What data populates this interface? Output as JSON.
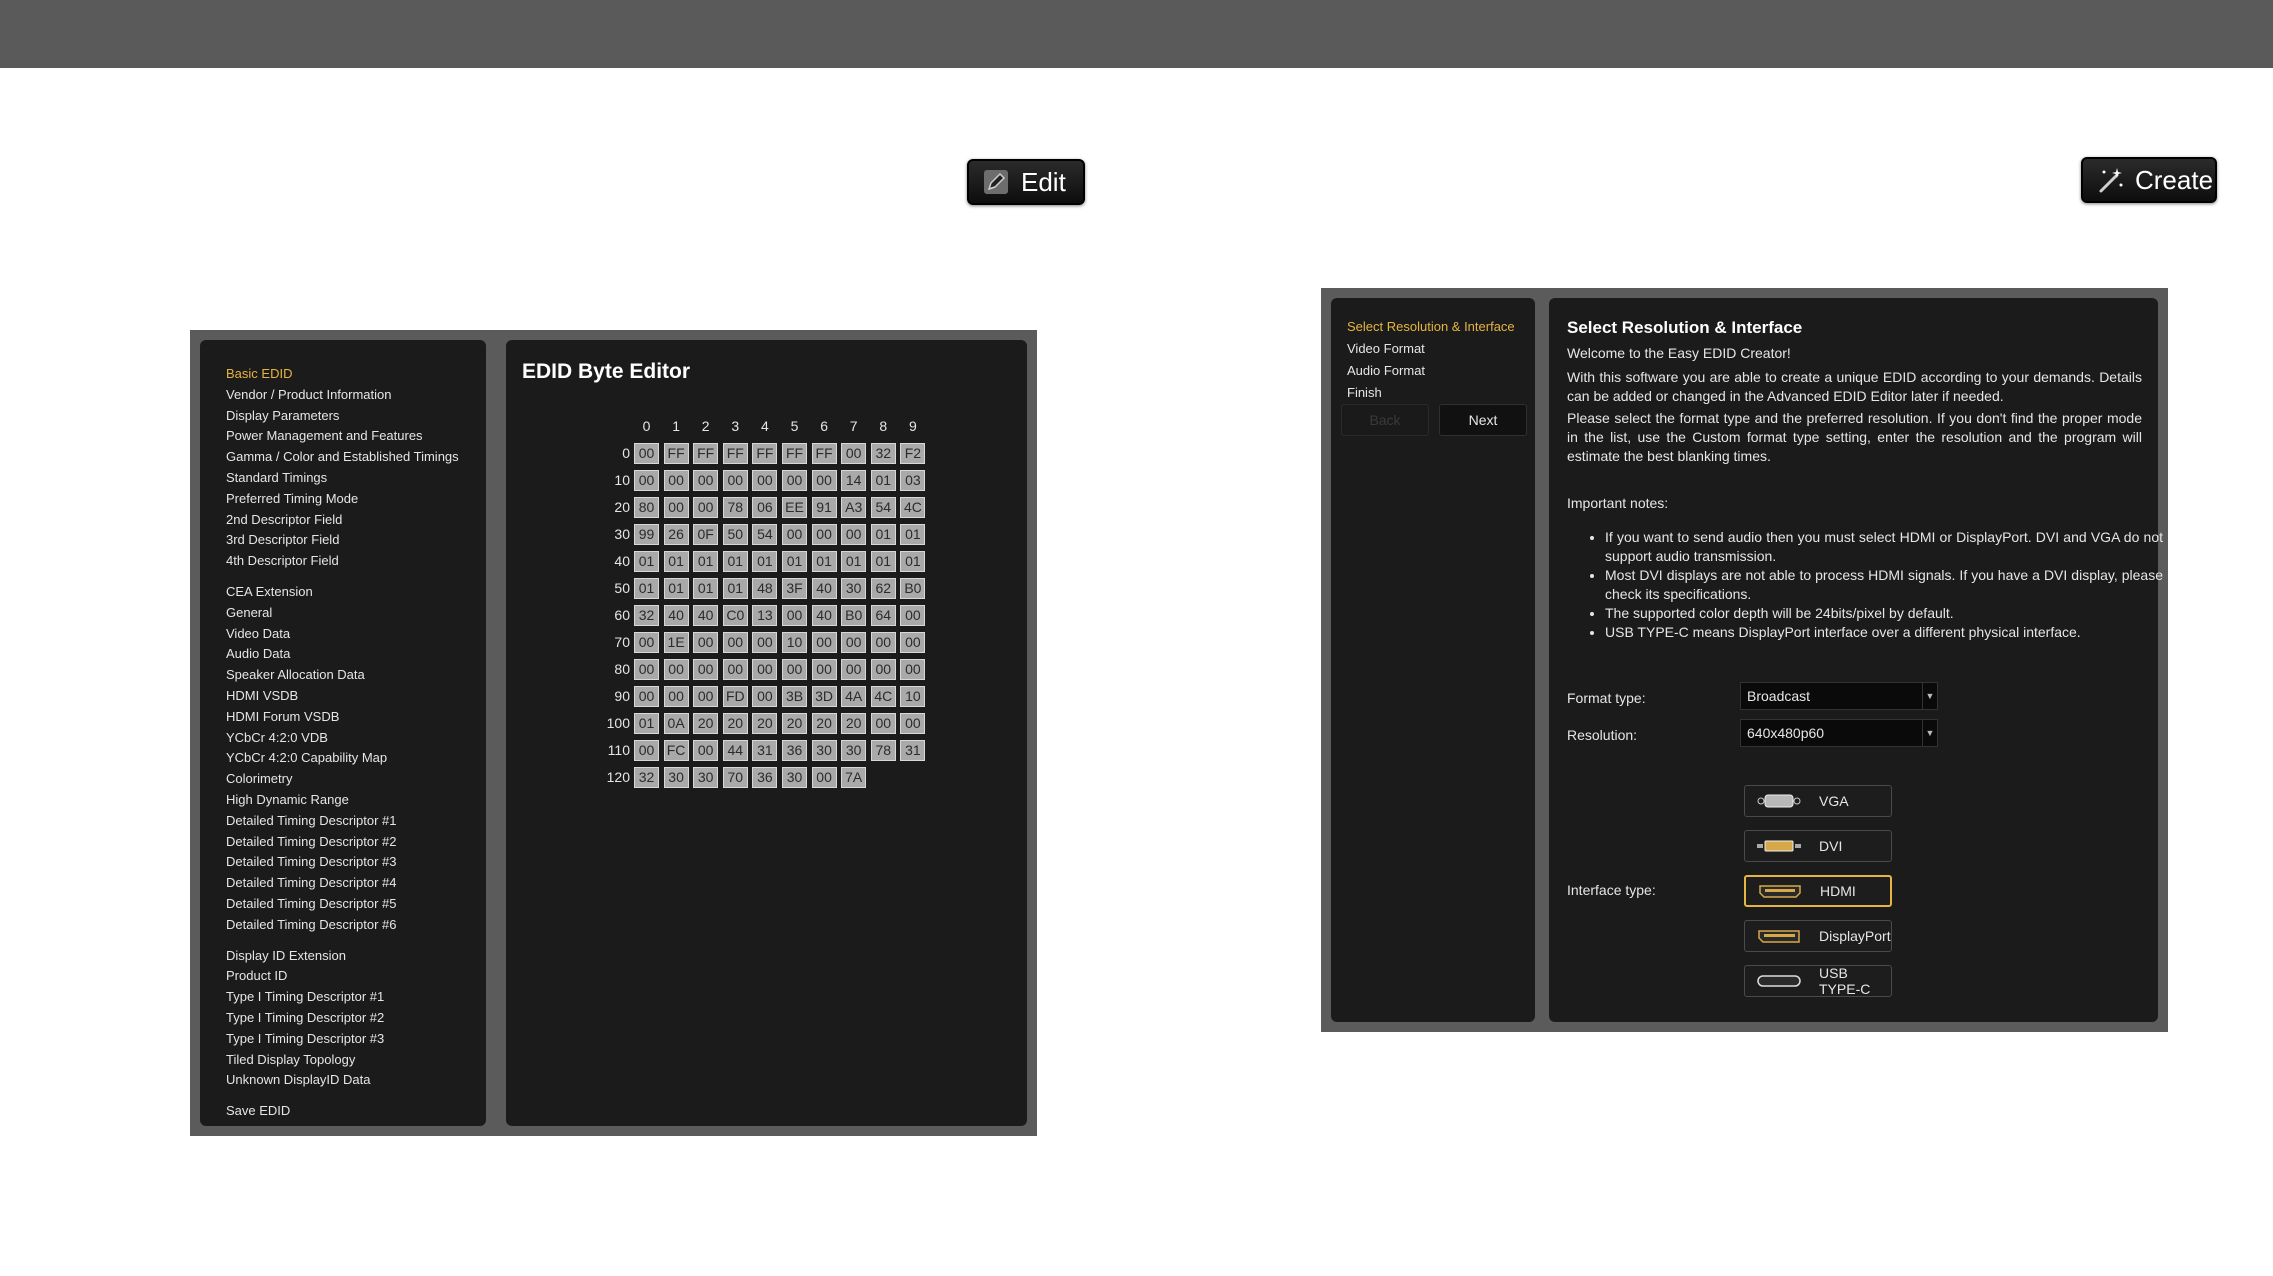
{
  "buttons": {
    "edit_label": "Edit",
    "create_label": "Create"
  },
  "editor": {
    "nav": {
      "basic": [
        "Basic EDID",
        "Vendor / Product Information",
        "Display Parameters",
        "Power Management and Features",
        "Gamma / Color and Established Timings",
        "Standard Timings",
        "Preferred Timing Mode",
        "2nd Descriptor Field",
        "3rd Descriptor Field",
        "4th Descriptor Field"
      ],
      "cea": [
        "CEA Extension",
        "General",
        "Video Data",
        "Audio Data",
        "Speaker Allocation Data",
        "HDMI VSDB",
        "HDMI Forum VSDB",
        "YCbCr 4:2:0 VDB",
        "YCbCr 4:2:0 Capability Map",
        "Colorimetry",
        "High Dynamic Range",
        "Detailed Timing Descriptor #1",
        "Detailed Timing Descriptor #2",
        "Detailed Timing Descriptor #3",
        "Detailed Timing Descriptor #4",
        "Detailed Timing Descriptor #5",
        "Detailed Timing Descriptor #6"
      ],
      "displayid": [
        "Display ID Extension",
        "Product ID",
        "Type I Timing Descriptor #1",
        "Type I Timing Descriptor #2",
        "Type I Timing Descriptor #3",
        "Tiled Display Topology",
        "Unknown DisplayID Data"
      ],
      "save": "Save EDID"
    },
    "title": "EDID Byte Editor",
    "columns": [
      "0",
      "1",
      "2",
      "3",
      "4",
      "5",
      "6",
      "7",
      "8",
      "9"
    ],
    "rows": [
      {
        "label": "0",
        "bytes": [
          "00",
          "FF",
          "FF",
          "FF",
          "FF",
          "FF",
          "FF",
          "00",
          "32",
          "F2"
        ]
      },
      {
        "label": "10",
        "bytes": [
          "00",
          "00",
          "00",
          "00",
          "00",
          "00",
          "00",
          "14",
          "01",
          "03"
        ]
      },
      {
        "label": "20",
        "bytes": [
          "80",
          "00",
          "00",
          "78",
          "06",
          "EE",
          "91",
          "A3",
          "54",
          "4C"
        ]
      },
      {
        "label": "30",
        "bytes": [
          "99",
          "26",
          "0F",
          "50",
          "54",
          "00",
          "00",
          "00",
          "01",
          "01"
        ]
      },
      {
        "label": "40",
        "bytes": [
          "01",
          "01",
          "01",
          "01",
          "01",
          "01",
          "01",
          "01",
          "01",
          "01"
        ]
      },
      {
        "label": "50",
        "bytes": [
          "01",
          "01",
          "01",
          "01",
          "48",
          "3F",
          "40",
          "30",
          "62",
          "B0"
        ]
      },
      {
        "label": "60",
        "bytes": [
          "32",
          "40",
          "40",
          "C0",
          "13",
          "00",
          "40",
          "B0",
          "64",
          "00"
        ]
      },
      {
        "label": "70",
        "bytes": [
          "00",
          "1E",
          "00",
          "00",
          "00",
          "10",
          "00",
          "00",
          "00",
          "00"
        ]
      },
      {
        "label": "80",
        "bytes": [
          "00",
          "00",
          "00",
          "00",
          "00",
          "00",
          "00",
          "00",
          "00",
          "00"
        ]
      },
      {
        "label": "90",
        "bytes": [
          "00",
          "00",
          "00",
          "FD",
          "00",
          "3B",
          "3D",
          "4A",
          "4C",
          "10"
        ]
      },
      {
        "label": "100",
        "bytes": [
          "01",
          "0A",
          "20",
          "20",
          "20",
          "20",
          "20",
          "20",
          "00",
          "00"
        ]
      },
      {
        "label": "110",
        "bytes": [
          "00",
          "FC",
          "00",
          "44",
          "31",
          "36",
          "30",
          "30",
          "78",
          "31"
        ]
      },
      {
        "label": "120",
        "bytes": [
          "32",
          "30",
          "30",
          "70",
          "36",
          "30",
          "00",
          "7A"
        ]
      }
    ]
  },
  "creator": {
    "steps": [
      "Select Resolution & Interface",
      "Video Format",
      "Audio Format",
      "Finish"
    ],
    "back_label": "Back",
    "next_label": "Next",
    "title": "Select Resolution & Interface",
    "welcome": "Welcome to the Easy EDID Creator!",
    "para1": "With this software you are able to create a unique EDID according to your demands. Details can be added or changed in the Advanced EDID Editor later if needed.",
    "para2": "Please select the format type and the preferred resolution. If you don't find the proper mode in the list, use the Custom format type setting, enter the resolution and the program will estimate the best blanking times.",
    "notes_heading": "Important notes:",
    "notes": [
      "If you want to send audio then you must select HDMI or DisplayPort. DVI and VGA do not support audio transmission.",
      "Most DVI displays are not able to process HDMI signals. If you have a DVI display, please check its specifications.",
      "The supported color depth will be 24bits/pixel by default.",
      "USB TYPE-C means DisplayPort interface over a different physical interface."
    ],
    "format_label": "Format type:",
    "format_value": "Broadcast",
    "resolution_label": "Resolution:",
    "resolution_value": "640x480p60",
    "interface_label": "Interface type:",
    "interfaces": [
      "VGA",
      "DVI",
      "HDMI",
      "DisplayPort",
      "USB TYPE-C"
    ],
    "selected_interface": "HDMI"
  },
  "colors": {
    "accent": "#e6b441",
    "panel_bg": "#1b1b1b",
    "frame": "#5b5b5b",
    "topbar": "#5a5a5a"
  }
}
